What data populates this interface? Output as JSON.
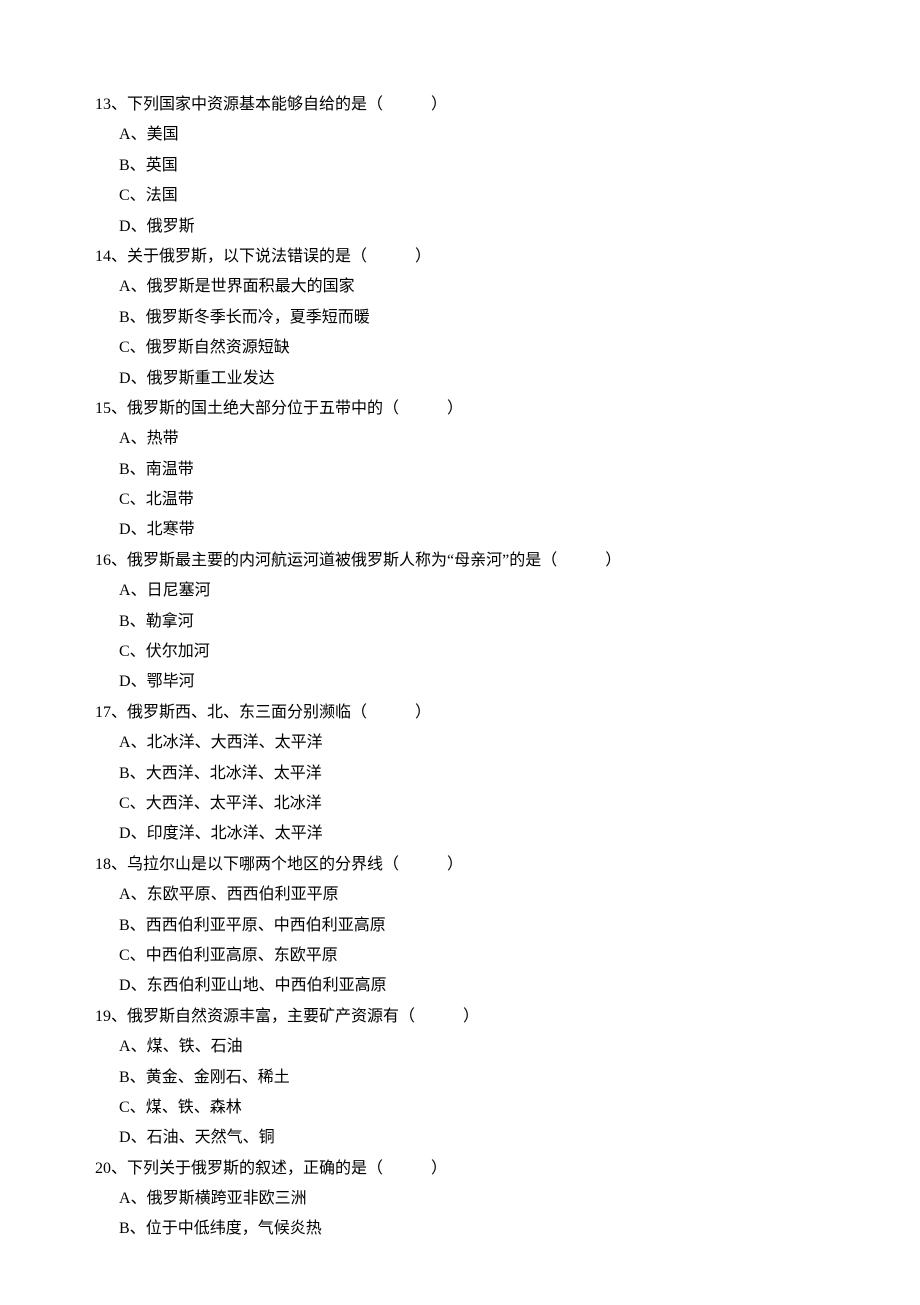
{
  "questions": [
    {
      "number": "13",
      "stem": "下列国家中资源基本能够自给的是（　　　）",
      "options": [
        {
          "label": "A",
          "text": "美国"
        },
        {
          "label": "B",
          "text": "英国"
        },
        {
          "label": "C",
          "text": "法国"
        },
        {
          "label": "D",
          "text": "俄罗斯"
        }
      ]
    },
    {
      "number": "14",
      "stem": "关于俄罗斯，以下说法错误的是（　　　）",
      "options": [
        {
          "label": "A",
          "text": "俄罗斯是世界面积最大的国家"
        },
        {
          "label": "B",
          "text": "俄罗斯冬季长而冷，夏季短而暖"
        },
        {
          "label": "C",
          "text": "俄罗斯自然资源短缺"
        },
        {
          "label": "D",
          "text": "俄罗斯重工业发达"
        }
      ]
    },
    {
      "number": "15",
      "stem": "俄罗斯的国土绝大部分位于五带中的（　　　）",
      "options": [
        {
          "label": "A",
          "text": "热带"
        },
        {
          "label": "B",
          "text": "南温带"
        },
        {
          "label": "C",
          "text": "北温带"
        },
        {
          "label": "D",
          "text": "北寒带"
        }
      ]
    },
    {
      "number": "16",
      "stem": "俄罗斯最主要的内河航运河道被俄罗斯人称为“母亲河”的是（　　　）",
      "options": [
        {
          "label": "A",
          "text": "日尼塞河"
        },
        {
          "label": "B",
          "text": "勒拿河"
        },
        {
          "label": "C",
          "text": "伏尔加河"
        },
        {
          "label": "D",
          "text": "鄂毕河"
        }
      ]
    },
    {
      "number": "17",
      "stem": "俄罗斯西、北、东三面分别濒临（　　　）",
      "options": [
        {
          "label": "A",
          "text": "北冰洋、大西洋、太平洋"
        },
        {
          "label": "B",
          "text": "大西洋、北冰洋、太平洋"
        },
        {
          "label": "C",
          "text": "大西洋、太平洋、北冰洋"
        },
        {
          "label": "D",
          "text": "印度洋、北冰洋、太平洋"
        }
      ]
    },
    {
      "number": "18",
      "stem": "乌拉尔山是以下哪两个地区的分界线（　　　）",
      "options": [
        {
          "label": "A",
          "text": "东欧平原、西西伯利亚平原"
        },
        {
          "label": "B",
          "text": "西西伯利亚平原、中西伯利亚高原"
        },
        {
          "label": "C",
          "text": "中西伯利亚高原、东欧平原"
        },
        {
          "label": "D",
          "text": "东西伯利亚山地、中西伯利亚高原"
        }
      ]
    },
    {
      "number": "19",
      "stem": "俄罗斯自然资源丰富，主要矿产资源有（　　　）",
      "options": [
        {
          "label": "A",
          "text": "煤、铁、石油"
        },
        {
          "label": "B",
          "text": "黄金、金刚石、稀土"
        },
        {
          "label": "C",
          "text": "煤、铁、森林"
        },
        {
          "label": "D",
          "text": "石油、天然气、铜"
        }
      ]
    },
    {
      "number": "20",
      "stem": "下列关于俄罗斯的叙述，正确的是（　　　）",
      "options": [
        {
          "label": "A",
          "text": "俄罗斯横跨亚非欧三洲"
        },
        {
          "label": "B",
          "text": "位于中低纬度，气候炎热"
        }
      ]
    }
  ]
}
